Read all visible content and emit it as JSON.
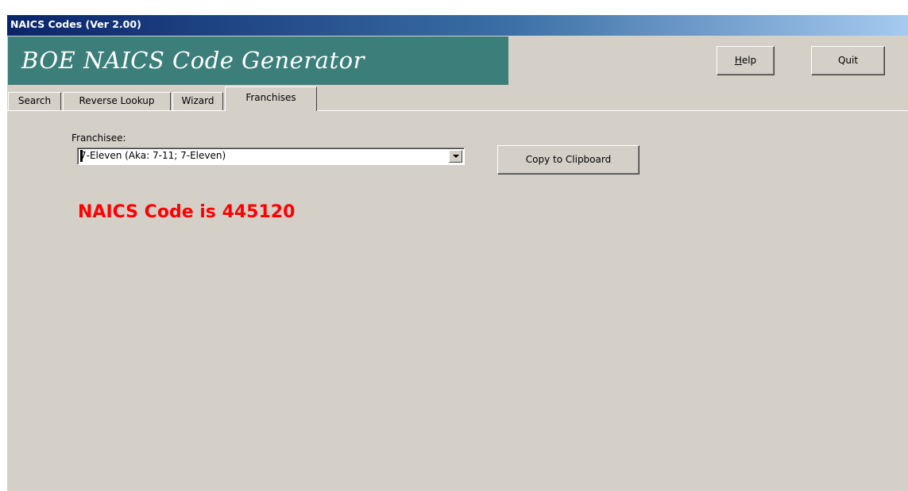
{
  "window": {
    "title": "NAICS Codes (Ver 2.00)"
  },
  "banner": {
    "text": "BOE NAICS Code Generator",
    "color": "#3c7f7a"
  },
  "toolbar": {
    "help_label_prefix": "",
    "help_label_mnemonic": "H",
    "help_label_rest": "elp",
    "quit_label": "Quit"
  },
  "tabs": [
    {
      "label": "Search",
      "active": false
    },
    {
      "label": "Reverse Lookup",
      "active": false
    },
    {
      "label": "Wizard",
      "active": false
    },
    {
      "label": "Franchises",
      "active": true
    }
  ],
  "franchises": {
    "franchisee_label": "Franchisee:",
    "selected_value": "7-Eleven (Aka: 7-11; 7-Eleven)",
    "copy_button_label": "Copy to Clipboard",
    "result_text": "NAICS Code is 445120",
    "result_color": "#ff0000"
  },
  "icons": {
    "dropdown": "chevron-down-icon"
  }
}
